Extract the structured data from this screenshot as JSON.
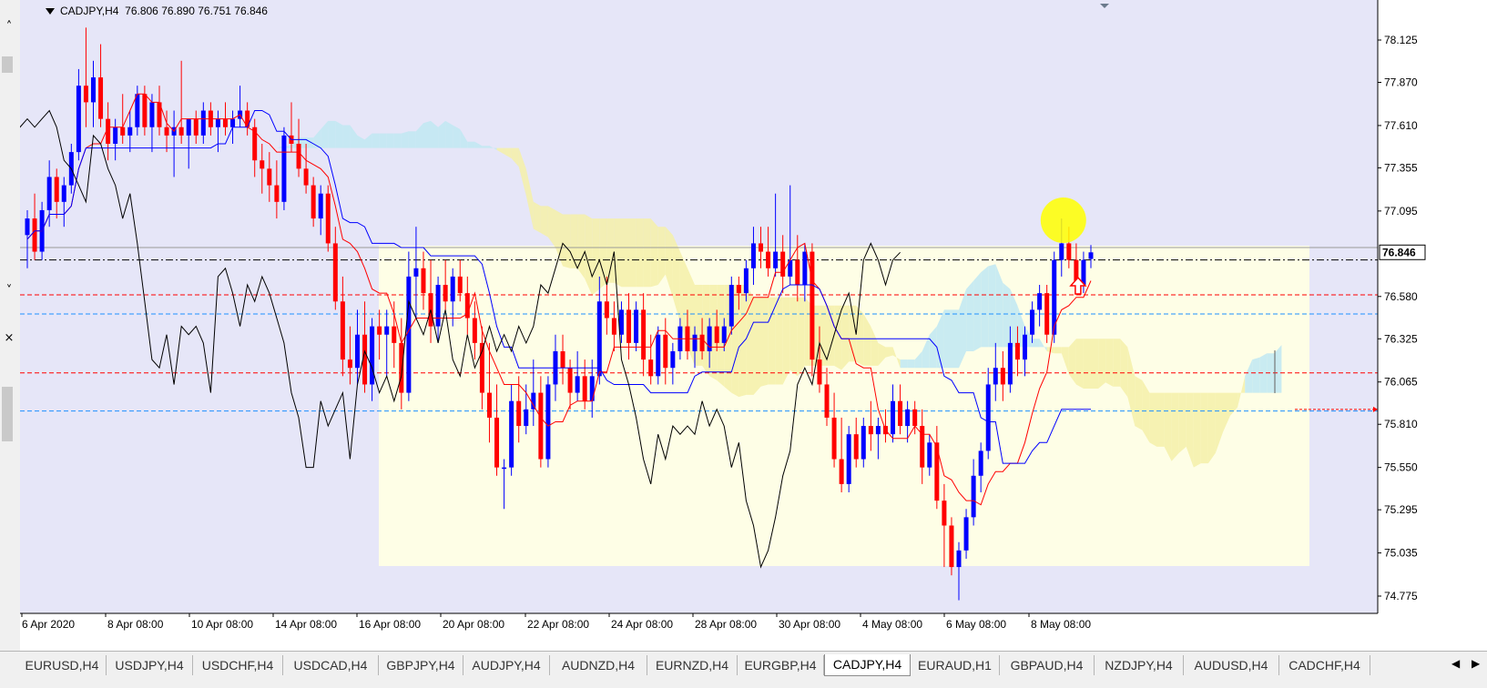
{
  "window": {
    "symbol_title": "CADJPY,H4",
    "ohlc": "76.806 76.890 76.751 76.846"
  },
  "price_axis": {
    "ticks": [
      "78.125",
      "77.870",
      "77.610",
      "77.355",
      "77.095",
      "76.580",
      "76.325",
      "76.065",
      "75.810",
      "75.550",
      "75.295",
      "75.035",
      "74.775"
    ],
    "current_price_label": "76.846"
  },
  "time_axis": {
    "labels": [
      "6 Apr 2020",
      "8 Apr 08:00",
      "10 Apr 08:00",
      "14 Apr 08:00",
      "16 Apr 08:00",
      "20 Apr 08:00",
      "22 Apr 08:00",
      "24 Apr 08:00",
      "28 Apr 08:00",
      "30 Apr 08:00",
      "4 May 08:00",
      "6 May 08:00",
      "8 May 08:00"
    ]
  },
  "tabs": [
    "EURUSD,H4",
    "USDJPY,H4",
    "USDCHF,H4",
    "USDCAD,H4",
    "GBPJPY,H4",
    "AUDJPY,H4",
    "AUDNZD,H4",
    "EURNZD,H4",
    "EURGBP,H4",
    "CADJPY,H4",
    "EURAUD,H1",
    "GBPAUD,H4",
    "NZDJPY,H4",
    "AUDUSD,H4",
    "CADCHF,H4"
  ],
  "active_tab": "CADJPY,H4",
  "icons": {
    "left_panel": [
      "chevron-up-icon",
      "chevron-down-icon",
      "close-icon"
    ],
    "tab_nav": [
      "arrow-left-icon",
      "arrow-right-icon"
    ],
    "chart": [
      "highlight-circle-icon",
      "up-arrow-signal-icon",
      "period-separator-icon"
    ]
  },
  "colors": {
    "background": "#e6e6f8",
    "highlight_zone": "#fefee6",
    "bull_candle": "#0000ff",
    "bear_candle": "#ff0000",
    "tenkan_line": "#ff0000",
    "kijun_line": "#0000ff",
    "chikou_line": "#000000",
    "cloud_bull": "#bfe8f2",
    "cloud_bear": "#f5f0a8",
    "marker": "#ffff00"
  },
  "chart_data": {
    "type": "candlestick",
    "ylim": [
      74.7,
      78.25
    ],
    "current_price": 76.846,
    "horizontal_lines": [
      {
        "price": 76.8,
        "style": "dash-dot",
        "color": "#000000"
      },
      {
        "price": 76.59,
        "style": "dashed",
        "color": "#ff0000"
      },
      {
        "price": 76.475,
        "style": "dashed",
        "color": "#1e90ff"
      },
      {
        "price": 76.12,
        "style": "dashed",
        "color": "#ff0000"
      },
      {
        "price": 75.89,
        "style": "dashed",
        "color": "#1e90ff"
      }
    ],
    "candles": [
      {
        "o": 76.95,
        "h": 77.1,
        "l": 76.75,
        "c": 77.05
      },
      {
        "o": 77.05,
        "h": 77.2,
        "l": 76.8,
        "c": 76.85
      },
      {
        "o": 76.85,
        "h": 77.15,
        "l": 76.8,
        "c": 77.1
      },
      {
        "o": 77.1,
        "h": 77.4,
        "l": 77.0,
        "c": 77.3
      },
      {
        "o": 77.3,
        "h": 77.35,
        "l": 77.05,
        "c": 77.15
      },
      {
        "o": 77.15,
        "h": 77.3,
        "l": 77.0,
        "c": 77.25
      },
      {
        "o": 77.25,
        "h": 77.5,
        "l": 77.2,
        "c": 77.45
      },
      {
        "o": 77.45,
        "h": 77.95,
        "l": 77.4,
        "c": 77.85
      },
      {
        "o": 77.85,
        "h": 78.2,
        "l": 77.6,
        "c": 77.75
      },
      {
        "o": 77.75,
        "h": 78.0,
        "l": 77.6,
        "c": 77.9
      },
      {
        "o": 77.9,
        "h": 78.1,
        "l": 77.6,
        "c": 77.65
      },
      {
        "o": 77.65,
        "h": 77.75,
        "l": 77.4,
        "c": 77.5
      },
      {
        "o": 77.5,
        "h": 77.65,
        "l": 77.4,
        "c": 77.6
      },
      {
        "o": 77.6,
        "h": 77.8,
        "l": 77.5,
        "c": 77.55
      },
      {
        "o": 77.55,
        "h": 77.7,
        "l": 77.45,
        "c": 77.6
      },
      {
        "o": 77.6,
        "h": 77.85,
        "l": 77.55,
        "c": 77.8
      },
      {
        "o": 77.8,
        "h": 77.85,
        "l": 77.55,
        "c": 77.6
      },
      {
        "o": 77.6,
        "h": 77.8,
        "l": 77.45,
        "c": 77.75
      },
      {
        "o": 77.75,
        "h": 77.85,
        "l": 77.55,
        "c": 77.6
      },
      {
        "o": 77.6,
        "h": 77.7,
        "l": 77.45,
        "c": 77.55
      },
      {
        "o": 77.55,
        "h": 77.7,
        "l": 77.3,
        "c": 77.6
      },
      {
        "o": 77.6,
        "h": 78.0,
        "l": 77.5,
        "c": 77.55
      },
      {
        "o": 77.55,
        "h": 77.65,
        "l": 77.35,
        "c": 77.65
      },
      {
        "o": 77.65,
        "h": 77.7,
        "l": 77.5,
        "c": 77.55
      },
      {
        "o": 77.55,
        "h": 77.75,
        "l": 77.5,
        "c": 77.7
      },
      {
        "o": 77.7,
        "h": 77.75,
        "l": 77.55,
        "c": 77.6
      },
      {
        "o": 77.6,
        "h": 77.7,
        "l": 77.45,
        "c": 77.65
      },
      {
        "o": 77.65,
        "h": 77.75,
        "l": 77.55,
        "c": 77.6
      },
      {
        "o": 77.6,
        "h": 77.7,
        "l": 77.5,
        "c": 77.65
      },
      {
        "o": 77.65,
        "h": 77.85,
        "l": 77.6,
        "c": 77.7
      },
      {
        "o": 77.7,
        "h": 77.75,
        "l": 77.55,
        "c": 77.6
      },
      {
        "o": 77.6,
        "h": 77.65,
        "l": 77.3,
        "c": 77.4
      },
      {
        "o": 77.4,
        "h": 77.5,
        "l": 77.2,
        "c": 77.35
      },
      {
        "o": 77.35,
        "h": 77.45,
        "l": 77.15,
        "c": 77.25
      },
      {
        "o": 77.25,
        "h": 77.4,
        "l": 77.05,
        "c": 77.15
      },
      {
        "o": 77.15,
        "h": 77.6,
        "l": 77.1,
        "c": 77.55
      },
      {
        "o": 77.55,
        "h": 77.75,
        "l": 77.45,
        "c": 77.5
      },
      {
        "o": 77.5,
        "h": 77.65,
        "l": 77.3,
        "c": 77.35
      },
      {
        "o": 77.35,
        "h": 77.5,
        "l": 77.2,
        "c": 77.25
      },
      {
        "o": 77.25,
        "h": 77.3,
        "l": 77.0,
        "c": 77.05
      },
      {
        "o": 77.05,
        "h": 77.25,
        "l": 76.95,
        "c": 77.2
      },
      {
        "o": 77.2,
        "h": 77.25,
        "l": 76.85,
        "c": 76.9
      },
      {
        "o": 76.9,
        "h": 77.0,
        "l": 76.5,
        "c": 76.55
      },
      {
        "o": 76.55,
        "h": 76.7,
        "l": 76.1,
        "c": 76.2
      },
      {
        "o": 76.2,
        "h": 76.4,
        "l": 76.05,
        "c": 76.15
      },
      {
        "o": 76.15,
        "h": 76.5,
        "l": 76.05,
        "c": 76.35
      },
      {
        "o": 76.35,
        "h": 76.55,
        "l": 76.0,
        "c": 76.05
      },
      {
        "o": 76.05,
        "h": 76.45,
        "l": 75.95,
        "c": 76.4
      },
      {
        "o": 76.4,
        "h": 76.5,
        "l": 76.2,
        "c": 76.35
      },
      {
        "o": 76.35,
        "h": 76.5,
        "l": 76.1,
        "c": 76.4
      },
      {
        "o": 76.4,
        "h": 76.55,
        "l": 76.15,
        "c": 76.3
      },
      {
        "o": 76.3,
        "h": 76.45,
        "l": 75.9,
        "c": 76.0
      },
      {
        "o": 76.0,
        "h": 76.85,
        "l": 75.95,
        "c": 76.7
      },
      {
        "o": 76.7,
        "h": 77.0,
        "l": 76.45,
        "c": 76.75
      },
      {
        "o": 76.75,
        "h": 76.85,
        "l": 76.5,
        "c": 76.6
      },
      {
        "o": 76.6,
        "h": 76.8,
        "l": 76.3,
        "c": 76.4
      },
      {
        "o": 76.4,
        "h": 76.7,
        "l": 76.3,
        "c": 76.65
      },
      {
        "o": 76.65,
        "h": 76.8,
        "l": 76.5,
        "c": 76.55
      },
      {
        "o": 76.55,
        "h": 76.75,
        "l": 76.4,
        "c": 76.7
      },
      {
        "o": 76.7,
        "h": 76.8,
        "l": 76.55,
        "c": 76.6
      },
      {
        "o": 76.6,
        "h": 76.7,
        "l": 76.35,
        "c": 76.45
      },
      {
        "o": 76.45,
        "h": 76.55,
        "l": 76.2,
        "c": 76.3
      },
      {
        "o": 76.3,
        "h": 76.4,
        "l": 75.9,
        "c": 76.0
      },
      {
        "o": 76.0,
        "h": 76.3,
        "l": 75.7,
        "c": 75.85
      },
      {
        "o": 75.85,
        "h": 76.05,
        "l": 75.5,
        "c": 75.55
      },
      {
        "o": 75.55,
        "h": 75.6,
        "l": 75.3,
        "c": 75.55
      },
      {
        "o": 75.55,
        "h": 76.05,
        "l": 75.5,
        "c": 75.95
      },
      {
        "o": 75.95,
        "h": 76.1,
        "l": 75.7,
        "c": 75.8
      },
      {
        "o": 75.8,
        "h": 76.05,
        "l": 75.75,
        "c": 75.9
      },
      {
        "o": 75.9,
        "h": 76.2,
        "l": 75.8,
        "c": 76.0
      },
      {
        "o": 76.0,
        "h": 76.1,
        "l": 75.55,
        "c": 75.6
      },
      {
        "o": 75.6,
        "h": 76.1,
        "l": 75.55,
        "c": 76.05
      },
      {
        "o": 76.05,
        "h": 76.35,
        "l": 75.95,
        "c": 76.25
      },
      {
        "o": 76.25,
        "h": 76.35,
        "l": 76.05,
        "c": 76.15
      },
      {
        "o": 76.15,
        "h": 76.2,
        "l": 75.9,
        "c": 76.0
      },
      {
        "o": 76.0,
        "h": 76.25,
        "l": 75.95,
        "c": 76.1
      },
      {
        "o": 76.1,
        "h": 76.2,
        "l": 75.9,
        "c": 75.95
      },
      {
        "o": 75.95,
        "h": 76.2,
        "l": 75.85,
        "c": 76.1
      },
      {
        "o": 76.1,
        "h": 76.7,
        "l": 76.05,
        "c": 76.55
      },
      {
        "o": 76.55,
        "h": 76.7,
        "l": 76.35,
        "c": 76.45
      },
      {
        "o": 76.45,
        "h": 76.55,
        "l": 76.25,
        "c": 76.35
      },
      {
        "o": 76.35,
        "h": 76.55,
        "l": 76.3,
        "c": 76.5
      },
      {
        "o": 76.5,
        "h": 76.6,
        "l": 76.2,
        "c": 76.3
      },
      {
        "o": 76.3,
        "h": 76.55,
        "l": 76.25,
        "c": 76.5
      },
      {
        "o": 76.5,
        "h": 76.6,
        "l": 76.1,
        "c": 76.2
      },
      {
        "o": 76.2,
        "h": 76.35,
        "l": 76.05,
        "c": 76.1
      },
      {
        "o": 76.1,
        "h": 76.4,
        "l": 76.05,
        "c": 76.35
      },
      {
        "o": 76.35,
        "h": 76.45,
        "l": 76.05,
        "c": 76.15
      },
      {
        "o": 76.15,
        "h": 76.3,
        "l": 76.05,
        "c": 76.25
      },
      {
        "o": 76.25,
        "h": 76.45,
        "l": 76.2,
        "c": 76.4
      },
      {
        "o": 76.4,
        "h": 76.5,
        "l": 76.2,
        "c": 76.25
      },
      {
        "o": 76.25,
        "h": 76.4,
        "l": 76.15,
        "c": 76.35
      },
      {
        "o": 76.35,
        "h": 76.45,
        "l": 76.2,
        "c": 76.25
      },
      {
        "o": 76.25,
        "h": 76.45,
        "l": 76.15,
        "c": 76.4
      },
      {
        "o": 76.4,
        "h": 76.5,
        "l": 76.25,
        "c": 76.3
      },
      {
        "o": 76.3,
        "h": 76.45,
        "l": 76.25,
        "c": 76.4
      },
      {
        "o": 76.4,
        "h": 76.7,
        "l": 76.35,
        "c": 76.65
      },
      {
        "o": 76.65,
        "h": 76.7,
        "l": 76.5,
        "c": 76.6
      },
      {
        "o": 76.6,
        "h": 76.8,
        "l": 76.55,
        "c": 76.75
      },
      {
        "o": 76.75,
        "h": 77.0,
        "l": 76.65,
        "c": 76.9
      },
      {
        "o": 76.9,
        "h": 77.0,
        "l": 76.75,
        "c": 76.85
      },
      {
        "o": 76.85,
        "h": 77.0,
        "l": 76.7,
        "c": 76.75
      },
      {
        "o": 76.75,
        "h": 77.2,
        "l": 76.7,
        "c": 76.85
      },
      {
        "o": 76.85,
        "h": 76.95,
        "l": 76.6,
        "c": 76.7
      },
      {
        "o": 76.7,
        "h": 77.25,
        "l": 76.65,
        "c": 76.8
      },
      {
        "o": 76.8,
        "h": 76.95,
        "l": 76.55,
        "c": 76.65
      },
      {
        "o": 76.65,
        "h": 76.9,
        "l": 76.55,
        "c": 76.85
      },
      {
        "o": 76.85,
        "h": 76.9,
        "l": 76.1,
        "c": 76.2
      },
      {
        "o": 76.2,
        "h": 76.4,
        "l": 76.0,
        "c": 76.05
      },
      {
        "o": 76.05,
        "h": 76.15,
        "l": 75.8,
        "c": 75.85
      },
      {
        "o": 75.85,
        "h": 76.0,
        "l": 75.55,
        "c": 75.6
      },
      {
        "o": 75.6,
        "h": 75.85,
        "l": 75.4,
        "c": 75.45
      },
      {
        "o": 75.45,
        "h": 75.8,
        "l": 75.4,
        "c": 75.75
      },
      {
        "o": 75.75,
        "h": 75.85,
        "l": 75.55,
        "c": 75.6
      },
      {
        "o": 75.6,
        "h": 75.85,
        "l": 75.55,
        "c": 75.8
      },
      {
        "o": 75.8,
        "h": 75.95,
        "l": 75.65,
        "c": 75.75
      },
      {
        "o": 75.75,
        "h": 75.85,
        "l": 75.6,
        "c": 75.8
      },
      {
        "o": 75.8,
        "h": 75.9,
        "l": 75.7,
        "c": 75.75
      },
      {
        "o": 75.75,
        "h": 76.05,
        "l": 75.7,
        "c": 75.95
      },
      {
        "o": 75.95,
        "h": 76.05,
        "l": 75.75,
        "c": 75.8
      },
      {
        "o": 75.8,
        "h": 75.95,
        "l": 75.7,
        "c": 75.9
      },
      {
        "o": 75.9,
        "h": 75.95,
        "l": 75.75,
        "c": 75.8
      },
      {
        "o": 75.8,
        "h": 75.9,
        "l": 75.45,
        "c": 75.55
      },
      {
        "o": 75.55,
        "h": 75.75,
        "l": 75.5,
        "c": 75.7
      },
      {
        "o": 75.7,
        "h": 75.8,
        "l": 75.3,
        "c": 75.35
      },
      {
        "o": 75.35,
        "h": 75.45,
        "l": 74.95,
        "c": 75.2
      },
      {
        "o": 75.2,
        "h": 75.25,
        "l": 74.9,
        "c": 74.95
      },
      {
        "o": 74.95,
        "h": 75.1,
        "l": 74.75,
        "c": 75.05
      },
      {
        "o": 75.05,
        "h": 75.3,
        "l": 75.0,
        "c": 75.25
      },
      {
        "o": 75.25,
        "h": 75.6,
        "l": 75.2,
        "c": 75.5
      },
      {
        "o": 75.5,
        "h": 75.7,
        "l": 75.4,
        "c": 75.65
      },
      {
        "o": 75.65,
        "h": 76.15,
        "l": 75.6,
        "c": 76.05
      },
      {
        "o": 76.05,
        "h": 76.3,
        "l": 75.95,
        "c": 76.15
      },
      {
        "o": 76.15,
        "h": 76.25,
        "l": 75.95,
        "c": 76.05
      },
      {
        "o": 76.05,
        "h": 76.4,
        "l": 76.0,
        "c": 76.3
      },
      {
        "o": 76.3,
        "h": 76.4,
        "l": 76.1,
        "c": 76.2
      },
      {
        "o": 76.2,
        "h": 76.4,
        "l": 76.1,
        "c": 76.35
      },
      {
        "o": 76.35,
        "h": 76.55,
        "l": 76.3,
        "c": 76.5
      },
      {
        "o": 76.5,
        "h": 76.65,
        "l": 76.4,
        "c": 76.6
      },
      {
        "o": 76.6,
        "h": 76.65,
        "l": 76.3,
        "c": 76.35
      },
      {
        "o": 76.35,
        "h": 76.85,
        "l": 76.3,
        "c": 76.8
      },
      {
        "o": 76.8,
        "h": 77.05,
        "l": 76.7,
        "c": 76.9
      },
      {
        "o": 76.9,
        "h": 77.0,
        "l": 76.75,
        "c": 76.8
      },
      {
        "o": 76.8,
        "h": 76.9,
        "l": 76.6,
        "c": 76.65
      },
      {
        "o": 76.65,
        "h": 76.85,
        "l": 76.6,
        "c": 76.8
      },
      {
        "o": 76.806,
        "h": 76.89,
        "l": 76.751,
        "c": 76.846
      }
    ]
  }
}
